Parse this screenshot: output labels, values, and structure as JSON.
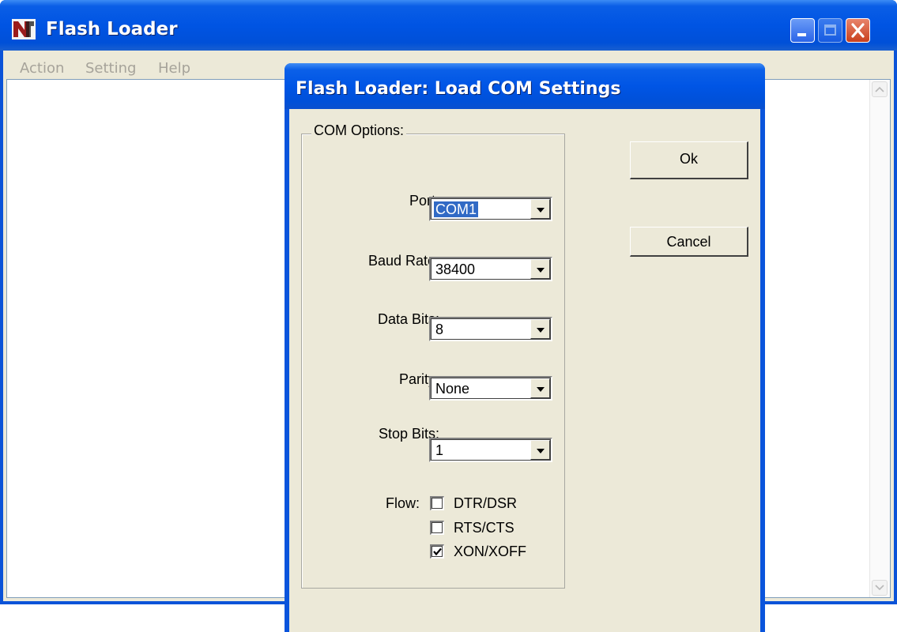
{
  "app": {
    "title": "Flash Loader",
    "menu": [
      "Action",
      "Setting",
      "Help"
    ]
  },
  "dialog": {
    "title": "Flash Loader: Load COM Settings",
    "group_label": "COM Options:",
    "fields": {
      "port": {
        "label": "Port:",
        "value": "COM1"
      },
      "baud_rate": {
        "label": "Baud Rate:",
        "value": "38400"
      },
      "data_bits": {
        "label": "Data Bits:",
        "value": "8"
      },
      "parity": {
        "label": "Parity:",
        "value": "None"
      },
      "stop_bits": {
        "label": "Stop Bits:",
        "value": "1"
      }
    },
    "flow": {
      "label": "Flow:",
      "options": [
        {
          "label": "DTR/DSR",
          "checked": false
        },
        {
          "label": "RTS/CTS",
          "checked": false
        },
        {
          "label": "XON/XOFF",
          "checked": true
        }
      ]
    },
    "buttons": {
      "ok": "Ok",
      "cancel": "Cancel"
    }
  },
  "icons": [
    "app-logo-icon",
    "minimize-icon",
    "maximize-icon",
    "close-icon",
    "scroll-up-icon",
    "scroll-down-icon",
    "dropdown-arrow-icon",
    "checkmark-icon"
  ],
  "colors": {
    "titlebar": "#0054e3",
    "face": "#ece9d8",
    "selection": "#316ac5",
    "close": "#c9401d"
  }
}
